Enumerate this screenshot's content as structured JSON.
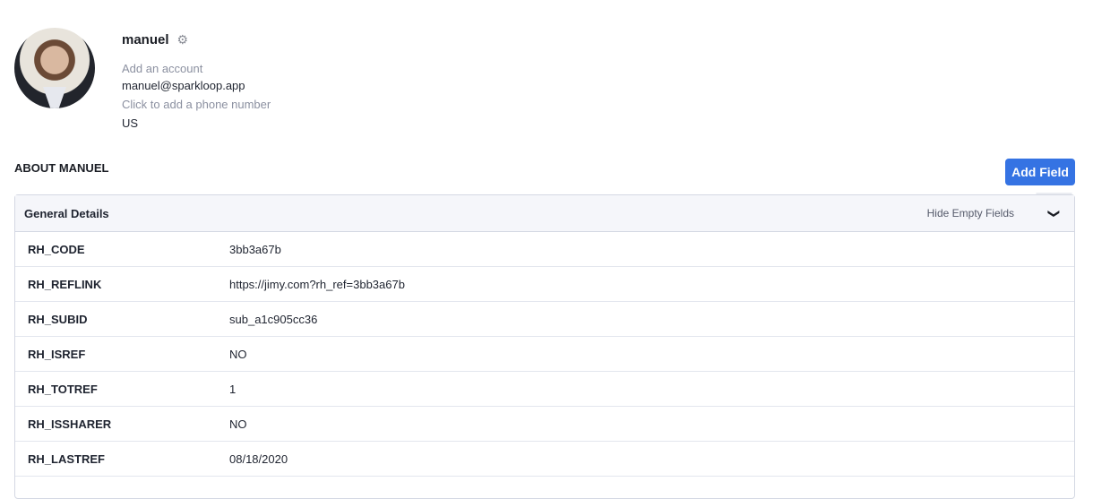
{
  "profile": {
    "name": "manuel",
    "account": "Add an account",
    "email": "manuel@sparkloop.app",
    "phone": "Click to add a phone number",
    "country": "US"
  },
  "about": {
    "title": "ABOUT MANUEL",
    "add_field": "Add Field"
  },
  "panel": {
    "title": "General Details",
    "hide_empty": "Hide Empty Fields",
    "rows": [
      {
        "key": "RH_CODE",
        "value": "3bb3a67b"
      },
      {
        "key": "RH_REFLINK",
        "value": "https://jimy.com?rh_ref=3bb3a67b"
      },
      {
        "key": "RH_SUBID",
        "value": "sub_a1c905cc36"
      },
      {
        "key": "RH_ISREF",
        "value": "NO"
      },
      {
        "key": "RH_TOTREF",
        "value": "1"
      },
      {
        "key": "RH_ISSHARER",
        "value": "NO"
      },
      {
        "key": "RH_LASTREF",
        "value": "08/18/2020"
      }
    ]
  }
}
